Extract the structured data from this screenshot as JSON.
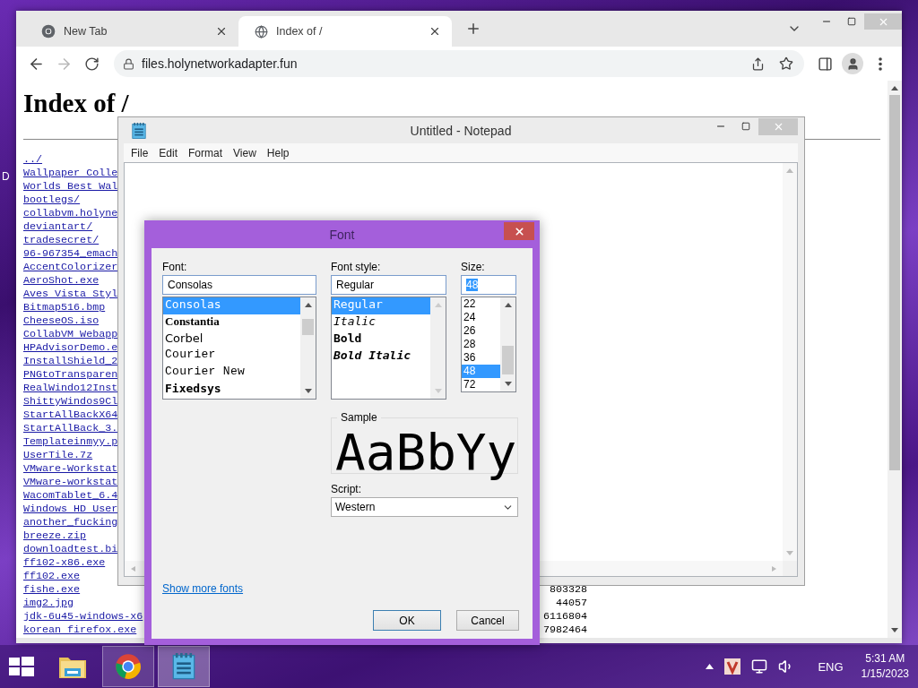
{
  "desktop": {
    "peek_label": "D"
  },
  "browser": {
    "tabs": [
      {
        "title": "New Tab",
        "kind": "app",
        "selected": false
      },
      {
        "title": "Index of /",
        "kind": "site",
        "selected": true
      }
    ],
    "forward_disabled": true,
    "address": "files.holynetworkadapter.fun",
    "page": {
      "heading": "Index of /",
      "entries": [
        {
          "name": "../"
        },
        {
          "name": "Wallpaper Colle"
        },
        {
          "name": "Worlds Best Wal"
        },
        {
          "name": "bootlegs/"
        },
        {
          "name": "collabvm.holyne"
        },
        {
          "name": "deviantart/"
        },
        {
          "name": "tradesecret/"
        },
        {
          "name": "96-967354_emach"
        },
        {
          "name": "AccentColorizer"
        },
        {
          "name": "AeroShot.exe"
        },
        {
          "name": "Aves Vista Styl"
        },
        {
          "name": "Bitmap516.bmp"
        },
        {
          "name": "CheeseOS.iso"
        },
        {
          "name": "CollabVM Webapp"
        },
        {
          "name": "HPAdvisorDemo.e"
        },
        {
          "name": "InstallShield_2"
        },
        {
          "name": "PNGtoTransparen"
        },
        {
          "name": "RealWindo12Inst"
        },
        {
          "name": "ShittyWindos9Cl"
        },
        {
          "name": "StartAllBackX64"
        },
        {
          "name": "StartAllBack_3."
        },
        {
          "name": "Templateinmyy.p"
        },
        {
          "name": "UserTile.7z"
        },
        {
          "name": "VMware-Workstat"
        },
        {
          "name": "VMware-workstat"
        },
        {
          "name": "WacomTablet_6.4"
        },
        {
          "name": "Windows HD User"
        },
        {
          "name": "another_fucking"
        },
        {
          "name": "breeze.zip"
        },
        {
          "name": "downloadtest.bi"
        },
        {
          "name": "ff102-x86.exe"
        },
        {
          "name": "ff102.exe"
        },
        {
          "name": "fishe.exe",
          "size": "803328"
        },
        {
          "name": "img2.jpg",
          "size": "44057"
        },
        {
          "name": "jdk-6u45-windows-x6",
          "size": "6116804"
        },
        {
          "name": "korean firefox.exe",
          "size": "7982464"
        }
      ]
    }
  },
  "notepad": {
    "title": "Untitled - Notepad",
    "menu": [
      "File",
      "Edit",
      "Format",
      "View",
      "Help"
    ]
  },
  "font_dialog": {
    "title": "Font",
    "font": {
      "label": "Font:",
      "value": "Consolas",
      "options": [
        {
          "name": "Consolas",
          "kind": "mono",
          "selected": true
        },
        {
          "name": "Constantia",
          "kind": "serif",
          "selected": false
        },
        {
          "name": "Corbel",
          "kind": "sans",
          "selected": false
        },
        {
          "name": "Courier",
          "kind": "typewriter",
          "selected": false
        },
        {
          "name": "Courier New",
          "kind": "typewriter",
          "selected": false
        },
        {
          "name": "Fixedsys",
          "kind": "bold-mono",
          "selected": false
        }
      ]
    },
    "style": {
      "label": "Font style:",
      "value": "Regular",
      "options": [
        {
          "name": "Regular",
          "kind": "regular",
          "selected": true
        },
        {
          "name": "Italic",
          "kind": "italic",
          "selected": false
        },
        {
          "name": "Bold",
          "kind": "bold",
          "selected": false
        },
        {
          "name": "Bold Italic",
          "kind": "bold-italic",
          "selected": false
        }
      ]
    },
    "size": {
      "label": "Size:",
      "value": "48",
      "value_highlighted": true,
      "options": [
        {
          "name": "22",
          "selected": false
        },
        {
          "name": "24",
          "selected": false
        },
        {
          "name": "26",
          "selected": false
        },
        {
          "name": "28",
          "selected": false
        },
        {
          "name": "36",
          "selected": false
        },
        {
          "name": "48",
          "selected": true
        },
        {
          "name": "72",
          "selected": false
        }
      ]
    },
    "sample": {
      "label": "Sample",
      "text": "AaBbYy"
    },
    "script": {
      "label": "Script:",
      "value": "Western"
    },
    "link": "Show more fonts",
    "buttons": [
      {
        "label": "OK",
        "default": true
      },
      {
        "label": "Cancel",
        "default": false
      }
    ]
  },
  "taskbar": {
    "apps": [
      {
        "kind": "files",
        "running": false,
        "selected": false
      },
      {
        "kind": "browser",
        "running": true,
        "selected": false
      },
      {
        "kind": "notepad",
        "running": true,
        "selected": true
      }
    ],
    "language": "ENG",
    "time": "5:31 AM",
    "date": "1/15/2023"
  }
}
